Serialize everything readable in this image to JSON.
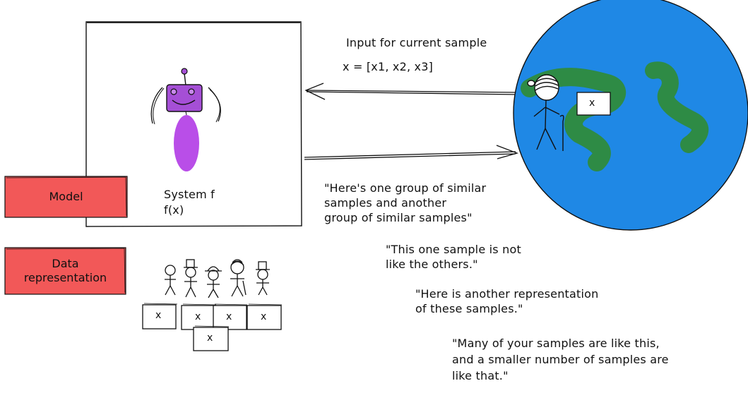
{
  "legend": {
    "model_label": "Model",
    "data_label": "Data\nrepresentation"
  },
  "system": {
    "line1": "System f",
    "line2": "f(x)"
  },
  "input": {
    "title": "Input for current sample",
    "vector": "x = [x1, x2, x3]"
  },
  "sample_card_mark": "x",
  "quotes": {
    "q1": "\"Here's one group of similar\nsamples and another\ngroup of similar samples\"",
    "q2": "\"This one sample is not\nlike the others.\"",
    "q3": "\"Here is another representation\nof these samples.\"",
    "q4": "\"Many of your samples are like this,\nand a smaller number of samples are\nlike that.\""
  },
  "colors": {
    "label_fill": "#f25858",
    "robot_head": "#a54fd6",
    "robot_body": "#b94ee8",
    "globe_ocean": "#1f88e5",
    "globe_land": "#2e8b45"
  }
}
